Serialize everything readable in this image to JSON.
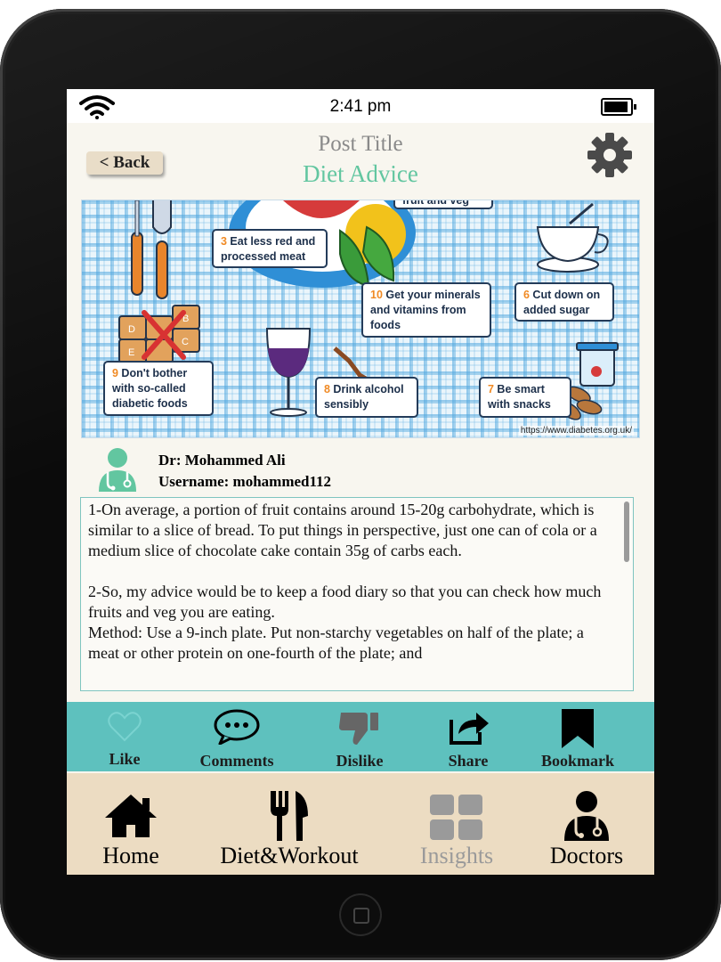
{
  "status_bar": {
    "time": "2:41 pm"
  },
  "header": {
    "back_label": "< Back",
    "title": "Post Title",
    "subtitle": "Diet Advice"
  },
  "hero": {
    "cards": [
      {
        "num": "",
        "text": "fruit and veg"
      },
      {
        "num": "3",
        "text": " Eat less red and processed meat"
      },
      {
        "num": "10",
        "text": " Get your minerals and vitamins from foods"
      },
      {
        "num": "6",
        "text": " Cut down on added sugar"
      },
      {
        "num": "9",
        "text": " Don't bother with so-called diabetic foods"
      },
      {
        "num": "8",
        "text": " Drink alcohol sensibly"
      },
      {
        "num": "7",
        "text": " Be smart with snacks"
      }
    ],
    "credit": "https://www.diabetes.org.uk/",
    "tile_letters": [
      "D",
      "B",
      "E",
      "C"
    ]
  },
  "author": {
    "name": "Dr:  Mohammed Ali",
    "username": "Username: mohammed112"
  },
  "post": {
    "body": "1-On average, a portion of fruit contains around 15-20g carbohydrate, which is similar to a slice of bread. To put things in perspective, just one can of cola or a medium slice of chocolate cake contain 35g of carbs each.\n\n2-So, my advice would be to keep a food diary so that you can check how much fruits and veg you are eating.\nMethod: Use a 9-inch plate. Put non-starchy vegetables on half of the plate; a meat or other protein on one-fourth of the plate; and"
  },
  "actions": [
    {
      "label": "Like",
      "icon": "heart-outline-icon"
    },
    {
      "label": "Comments",
      "icon": "speech-bubble-icon"
    },
    {
      "label": "Dislike",
      "icon": "thumbs-down-icon"
    },
    {
      "label": "Share",
      "icon": "share-icon"
    },
    {
      "label": "Bookmark",
      "icon": "bookmark-icon"
    }
  ],
  "nav": [
    {
      "label": "Home",
      "icon": "home-icon"
    },
    {
      "label": "Diet&Workout",
      "icon": "fork-knife-icon"
    },
    {
      "label": "Insights",
      "icon": "grid-icon"
    },
    {
      "label": "Doctors",
      "icon": "doctor-icon"
    }
  ],
  "colors": {
    "accent_green": "#62c6a0",
    "action_bar": "#5ec1be",
    "nav_bar": "#ecdcc2",
    "background": "#f8f6ef"
  }
}
